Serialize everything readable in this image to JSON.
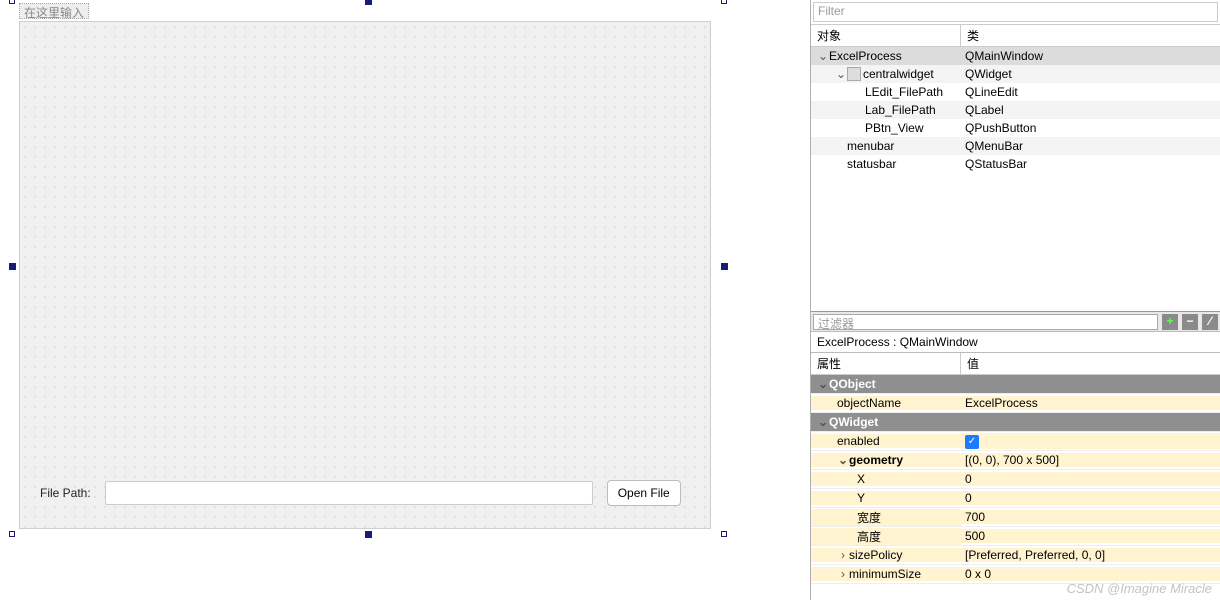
{
  "designer": {
    "menu_placeholder": "在这里输入",
    "file_label": "File Path:",
    "file_value": "",
    "open_button": "Open File"
  },
  "object_panel": {
    "filter_placeholder": "Filter",
    "col_object": "对象",
    "col_class": "类",
    "rows": [
      {
        "name": "ExcelProcess",
        "cls": "QMainWindow",
        "depth": 0,
        "expandable": true,
        "expanded": true,
        "selected": true
      },
      {
        "name": "centralwidget",
        "cls": "QWidget",
        "depth": 1,
        "expandable": true,
        "expanded": true,
        "icon": true
      },
      {
        "name": "LEdit_FilePath",
        "cls": "QLineEdit",
        "depth": 2
      },
      {
        "name": "Lab_FilePath",
        "cls": "QLabel",
        "depth": 2
      },
      {
        "name": "PBtn_View",
        "cls": "QPushButton",
        "depth": 2
      },
      {
        "name": "menubar",
        "cls": "QMenuBar",
        "depth": 1
      },
      {
        "name": "statusbar",
        "cls": "QStatusBar",
        "depth": 1
      }
    ]
  },
  "property_panel": {
    "filter_placeholder": "过滤器",
    "title": "ExcelProcess : QMainWindow",
    "col_name": "属性",
    "col_value": "值",
    "rows": [
      {
        "type": "group",
        "name": "QObject"
      },
      {
        "type": "prop",
        "name": "objectName",
        "value": "ExcelProcess",
        "indent": 1
      },
      {
        "type": "group",
        "name": "QWidget"
      },
      {
        "type": "prop",
        "name": "enabled",
        "value": "check",
        "indent": 1
      },
      {
        "type": "prop",
        "name": "geometry",
        "value": "[(0, 0), 700 x 500]",
        "indent": 1,
        "expandable": true,
        "expanded": true,
        "bold": true
      },
      {
        "type": "prop",
        "name": "X",
        "value": "0",
        "indent": 2
      },
      {
        "type": "prop",
        "name": "Y",
        "value": "0",
        "indent": 2
      },
      {
        "type": "prop",
        "name": "宽度",
        "value": "700",
        "indent": 2
      },
      {
        "type": "prop",
        "name": "高度",
        "value": "500",
        "indent": 2
      },
      {
        "type": "prop",
        "name": "sizePolicy",
        "value": "[Preferred, Preferred, 0, 0]",
        "indent": 1,
        "expandable": true,
        "expanded": false
      },
      {
        "type": "prop",
        "name": "minimumSize",
        "value": "0 x 0",
        "indent": 1,
        "expandable": true,
        "expanded": false
      }
    ]
  },
  "toolbar_icons": {
    "add": "+",
    "minus": "−",
    "div": "⁄"
  },
  "watermark": "CSDN @Imagine Miracle"
}
